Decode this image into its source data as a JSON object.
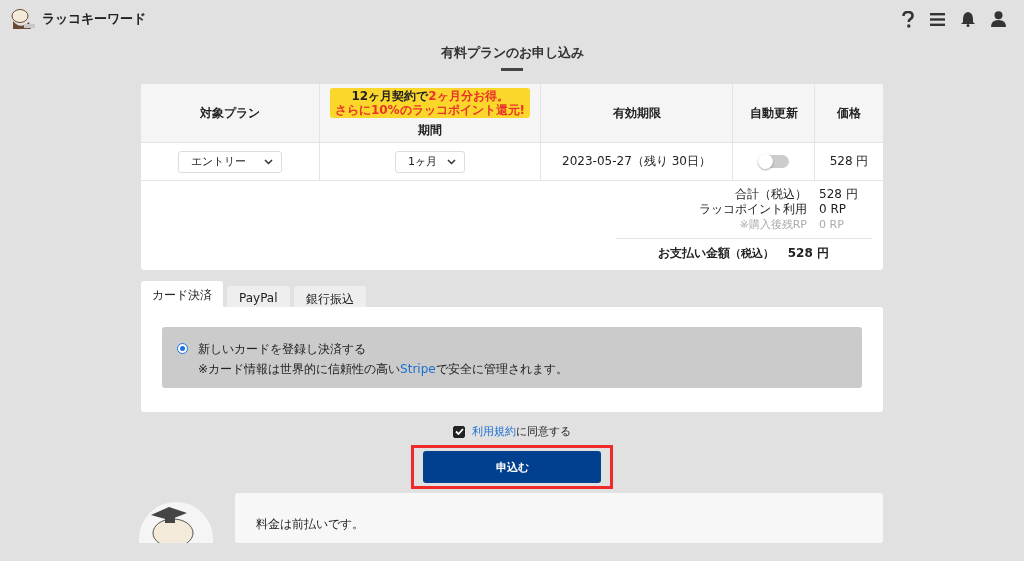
{
  "header": {
    "logo_text": "ラッコキーワード"
  },
  "page_title": "有料プランのお申し込み",
  "plan_table": {
    "promo_badge": [
      [
        {
          "text": "12ヶ月契約で",
          "emphasis": false
        },
        {
          "text": "2ヶ月分お得。",
          "emphasis": true
        }
      ],
      [
        {
          "text": "さらに10%のラッコポイント還元!",
          "emphasis": true
        }
      ]
    ],
    "columns": [
      "対象プラン",
      "期間",
      "有効期限",
      "自動更新",
      "価格"
    ],
    "row": {
      "plan": "エントリー",
      "period": "1ヶ月",
      "expiry": "2023-05-27（残り 30日）",
      "auto_renew": {
        "on": false
      },
      "price": "528 円"
    }
  },
  "summary": {
    "lines": [
      {
        "label": "合計（税込）",
        "value": "528 円",
        "muted": false
      },
      {
        "label": "ラッコポイント利用",
        "value": "0 RP",
        "muted": false
      },
      {
        "label": "※購入後残RP",
        "value": "0 RP",
        "muted": true
      }
    ],
    "total_label": "お支払い金額",
    "total_note": "（税込）",
    "total_value": "528 円"
  },
  "payment_tabs": [
    {
      "label": "カード決済",
      "selected": true
    },
    {
      "label": "PayPal",
      "selected": false
    },
    {
      "label": "銀行振込",
      "selected": false
    }
  ],
  "card_option": {
    "selected": true,
    "label": "新しいカードを登録し決済する",
    "note_before": "※カード情報は世界的に信頼性の高い",
    "note_link": "Stripe",
    "note_after": "で安全に管理されます。"
  },
  "terms": {
    "checked": true,
    "link": "利用規約",
    "text": "に同意する"
  },
  "submit_button": "申込む",
  "info_bubble": {
    "text": "料金は前払いです。"
  }
}
